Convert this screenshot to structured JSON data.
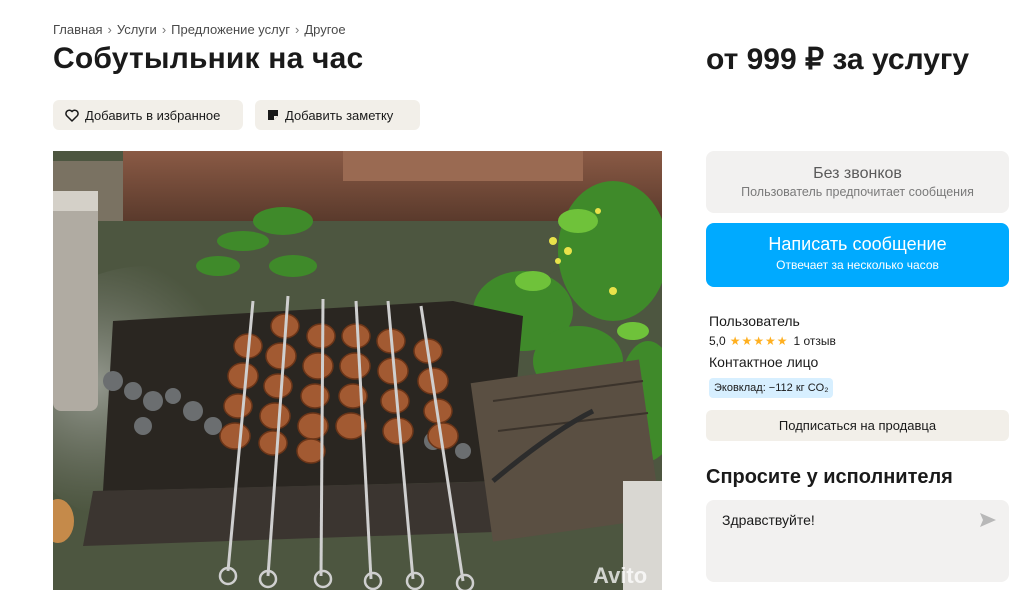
{
  "breadcrumb": {
    "items": [
      "Главная",
      "Услуги",
      "Предложение услуг",
      "Другое"
    ],
    "separator": "›"
  },
  "title": "Собутыльник на час",
  "price": "от 999 ₽ за услугу",
  "actions": {
    "favorite_label": "Добавить в избранное",
    "note_label": "Добавить заметку"
  },
  "photo": {
    "watermark": "Avito"
  },
  "contact_panel": {
    "no_calls_title": "Без звонков",
    "no_calls_subtitle": "Пользователь предпочитает сообщения",
    "message_button_label": "Написать сообщение",
    "message_button_subtitle": "Отвечает за несколько часов"
  },
  "seller": {
    "name": "Пользователь",
    "rating_value": "5,0",
    "stars": "★★★★★",
    "reviews": "1 отзыв",
    "contact_person": "Контактное лицо",
    "eco_badge": "Эковклад: −112 кг CO₂",
    "subscribe_label": "Подписаться на продавца"
  },
  "ask": {
    "title": "Спросите у исполнителя",
    "message_value": "Здравствуйте!"
  },
  "colors": {
    "accent": "#00aaff",
    "star": "#ffb021",
    "chip_bg": "#f2efe9",
    "eco_bg": "#d7efff"
  }
}
